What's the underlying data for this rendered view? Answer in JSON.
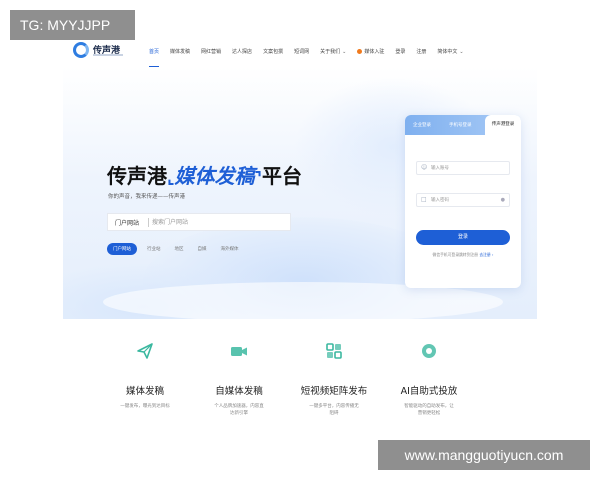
{
  "watermark": {
    "top_left": "TG: MYYJJPP",
    "bottom_right": "www.mangguotiyucn.com"
  },
  "header": {
    "logo_text": "传声港",
    "nav": [
      {
        "label": "首页",
        "active": true
      },
      {
        "label": "媒体发稿"
      },
      {
        "label": "网红营销"
      },
      {
        "label": "达人探店"
      },
      {
        "label": "文案包撰"
      },
      {
        "label": "短词网"
      },
      {
        "label": "关于我们",
        "has_dropdown": true
      },
      {
        "label": "媒体入驻",
        "has_dot": true
      },
      {
        "label": "登录"
      },
      {
        "label": "注册"
      },
      {
        "label": "简体中文",
        "has_dropdown": true
      }
    ]
  },
  "hero": {
    "title_prefix": "传声港",
    "title_highlight": "媒体发稿",
    "title_suffix": "平台",
    "bracket_open": "⌞",
    "bracket_close": "⌝",
    "subtitle": "你的声音，我来传递——传声港",
    "search": {
      "category": "门户网站",
      "placeholder": "搜索门户网站"
    },
    "chips": [
      {
        "label": "门户网站",
        "active": true
      },
      {
        "label": "行业站"
      },
      {
        "label": "地区"
      },
      {
        "label": "自媒"
      },
      {
        "label": "海外媒体"
      }
    ]
  },
  "login": {
    "tabs": [
      "企业登录",
      "手机号登录",
      "传声港登录"
    ],
    "active_tab": 2,
    "username_placeholder": "输入账号",
    "password_placeholder": "输入密码",
    "button": "登录",
    "note_prefix": "微信手机可登录跳转到注册",
    "note_link": "去注册 ›"
  },
  "services": [
    {
      "title": "媒体发稿",
      "desc": "一键发布，曝光到达目标",
      "icon": "paper-plane-icon",
      "color": "#3bb8a0"
    },
    {
      "title": "自媒体发稿",
      "desc": "个人品牌加速器，内容直达新引擎",
      "icon": "video-camera-icon",
      "color": "#3bb8a0"
    },
    {
      "title": "短视频矩阵发布",
      "desc": "一键多平台，内容传播无阻碍",
      "icon": "grid-icon",
      "color": "#3bb8a0"
    },
    {
      "title": "AI自助式投放",
      "desc": "智能驱动的自助发布，让营销更轻松",
      "icon": "ai-chip-icon",
      "color": "#3bb8a0"
    }
  ]
}
